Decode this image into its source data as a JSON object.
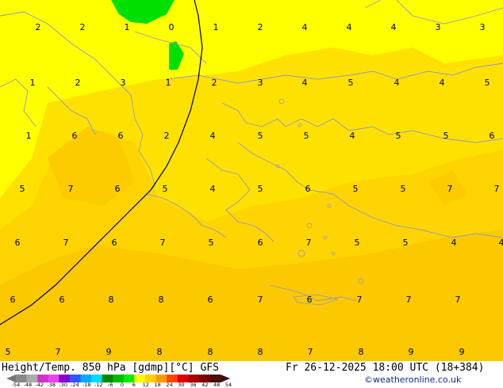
{
  "map": {
    "contour_values": [
      [
        "2",
        "2",
        "1",
        "0",
        "1",
        "2",
        "4",
        "4",
        "4",
        "3",
        "3"
      ],
      [
        "1",
        "2",
        "3",
        "1",
        "2",
        "3",
        "4",
        "5",
        "4",
        "4",
        "5"
      ],
      [
        "1",
        "6",
        "6",
        "2",
        "4",
        "5",
        "5",
        "4",
        "5",
        "5",
        "6"
      ],
      [
        "5",
        "7",
        "6",
        "5",
        "4",
        "5",
        "6",
        "5",
        "5",
        "7",
        "7"
      ],
      [
        "6",
        "7",
        "6",
        "7",
        "5",
        "6",
        "7",
        "5",
        "5",
        "4",
        "4"
      ],
      [
        "6",
        "6",
        "8",
        "8",
        "6",
        "7",
        "6",
        "7",
        "7",
        "7"
      ],
      [
        "5",
        "7",
        "9",
        "8",
        "8",
        "8",
        "7",
        "8",
        "9",
        "9"
      ]
    ],
    "colors": {
      "ocean_yellow": "#ffff00",
      "light_orange": "#ffe000",
      "orange": "#ffd000",
      "deep_orange": "#fbc000",
      "green": "#00e000",
      "coast": "#9999bb"
    }
  },
  "footer": {
    "title": "Height/Temp. 850 hPa [gdmp][°C] GFS",
    "datetime": "Fr 26-12-2025 18:00 UTC (18+384)",
    "credit": "©weatheronline.co.uk",
    "scale_ticks": [
      "-54",
      "-48",
      "-42",
      "-38",
      "-30",
      "-24",
      "-18",
      "-12",
      "-6",
      "0",
      "6",
      "12",
      "18",
      "24",
      "30",
      "36",
      "42",
      "48",
      "54"
    ],
    "scale_colors": [
      "#8a8a8a",
      "#aaaaaa",
      "#cc33cc",
      "#ee44ee",
      "#8800cc",
      "#3355ff",
      "#00aaff",
      "#00ddff",
      "#008800",
      "#00bb00",
      "#00ee00",
      "#ffff00",
      "#ffd000",
      "#ff9900",
      "#ff4400",
      "#dd0000",
      "#aa0000",
      "#7a0000",
      "#4a1010"
    ]
  }
}
